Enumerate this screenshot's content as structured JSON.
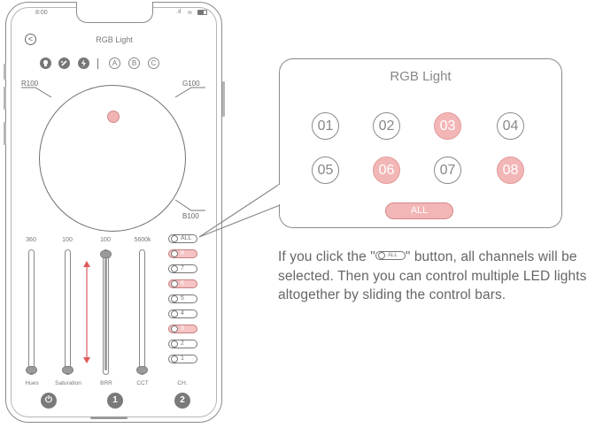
{
  "status_bar": {
    "time": "8:00",
    "signal": ".ıl",
    "wifi": "≈",
    "battery": "▭"
  },
  "header": {
    "title": "RGB Light",
    "back": "<"
  },
  "modes": {
    "icons": [
      "bulb-icon",
      "palette-icon",
      "lightning-icon"
    ],
    "letters": [
      "A",
      "B",
      "C"
    ]
  },
  "wheel": {
    "label_r": "R100",
    "label_g": "G100",
    "label_b": "B100"
  },
  "sliders": [
    {
      "head": "360",
      "foot": "Hues",
      "level": 0.0
    },
    {
      "head": "100",
      "foot": "Saturation",
      "level": 0.0
    },
    {
      "head": "100",
      "foot": "BRR",
      "level": 1.0
    },
    {
      "head": "5600k",
      "foot": "CCT",
      "level": 0.0
    }
  ],
  "channels": {
    "header": "CH.",
    "all_label": "ALL",
    "items": [
      {
        "label": "8",
        "selected": true
      },
      {
        "label": "7",
        "selected": false
      },
      {
        "label": "6",
        "selected": true
      },
      {
        "label": "5",
        "selected": false
      },
      {
        "label": "4",
        "selected": false
      },
      {
        "label": "3",
        "selected": true
      },
      {
        "label": "2",
        "selected": false
      },
      {
        "label": "1",
        "selected": false
      }
    ]
  },
  "bottom": {
    "power": "⏻",
    "group1": "1",
    "group2": "2"
  },
  "zoom": {
    "title": "RGB Light",
    "channels": [
      {
        "label": "01",
        "selected": false
      },
      {
        "label": "02",
        "selected": false
      },
      {
        "label": "03",
        "selected": true
      },
      {
        "label": "04",
        "selected": false
      },
      {
        "label": "05",
        "selected": false
      },
      {
        "label": "06",
        "selected": true
      },
      {
        "label": "07",
        "selected": false
      },
      {
        "label": "08",
        "selected": true
      }
    ],
    "all_label": "ALL"
  },
  "caption": {
    "part1": "If you click the \"",
    "pill_text": "ALL",
    "part2": "\" button, all channels will be selected. Then you can control multiple LED lights altogether by sliding the control bars."
  },
  "colors": {
    "accent": "#f3b6b6",
    "arrow": "#e05a5a",
    "line": "#8a8a8a"
  }
}
